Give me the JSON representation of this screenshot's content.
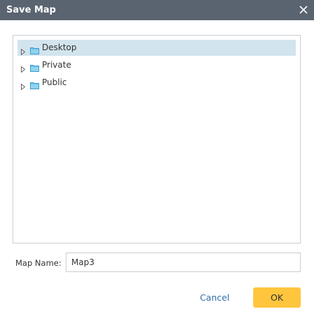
{
  "dialog": {
    "title": "Save Map",
    "close_icon": "close-icon"
  },
  "tree": {
    "items": [
      {
        "label": "Desktop",
        "selected": true,
        "icon": "folder-icon"
      },
      {
        "label": "Private",
        "selected": false,
        "icon": "folder-icon"
      },
      {
        "label": "Public",
        "selected": false,
        "icon": "folder-icon"
      }
    ]
  },
  "form": {
    "map_name_label": "Map Name:",
    "map_name_value": "Map3"
  },
  "buttons": {
    "cancel_label": "Cancel",
    "ok_label": "OK"
  },
  "colors": {
    "titlebar": "#5a6470",
    "selection": "#d2e4ee",
    "ok_button": "#ffc53d",
    "link": "#2e6fa8",
    "folder": "#6ec3ea"
  }
}
